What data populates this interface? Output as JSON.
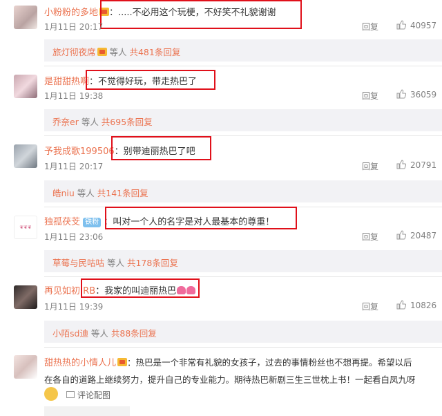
{
  "comments": [
    {
      "user": "小粉粉的多地",
      "text": "：.....不必用这个玩梗，不好笑不礼貌谢谢",
      "time": "1月11日 20:17",
      "reply": "回复",
      "likes": "40957",
      "sub": {
        "name": "旅灯彻夜席",
        "mid": " 等人 ",
        "count": "共481条回复"
      }
    },
    {
      "user": "是甜甜热啊",
      "text": "：不觉得好玩，带走热巴了",
      "time": "1月11日 19:38",
      "reply": "回复",
      "likes": "36059",
      "sub": {
        "name": "乔奈er",
        "mid": " 等人 ",
        "count": "共695条回复"
      }
    },
    {
      "user": "予我成歌199506",
      "text": "：别带迪丽热巴了吧",
      "time": "1月11日 20:17",
      "reply": "回复",
      "likes": "20791",
      "sub": {
        "name": "皓niu",
        "mid": " 等人 ",
        "count": "共141条回复"
      }
    },
    {
      "user": "独孤茯芠",
      "tag": "铁粉",
      "text": "：叫对一个人的名字是对人最基本的尊重！",
      "time": "1月11日 23:06",
      "reply": "回复",
      "likes": "20487",
      "sub": {
        "name": "草莓与民咕咕",
        "mid": " 等人 ",
        "count": "共178条回复"
      }
    },
    {
      "user": "再见如初",
      "mention": "RB",
      "text": "：我家的叫迪丽热巴",
      "time": "1月11日 19:39",
      "reply": "回复",
      "likes": "10826",
      "sub": {
        "name": "小陌sd迪",
        "mid": " 等人 ",
        "count": "共88条回复"
      }
    },
    {
      "user": "甜热热的小情人儿",
      "text1": "：热巴是一个非常有礼貌的女孩子，过去的事情粉丝也不想再提。希望以后",
      "text2": "在各自的道路上继续努力，提升自己的专业能力。期待热巴新剧三生三世枕上书！一起看白凤九呀",
      "link": "评论配图"
    }
  ],
  "icons": {
    "like": "thumbs-up-icon",
    "image": "image-icon",
    "emoji": "emoji-icon",
    "crown": "member-crown-icon"
  },
  "colors": {
    "username": "#eb7350",
    "highlight_box": "#e0101a",
    "muted": "#808080",
    "sub_bg": "#f2f2f5"
  }
}
